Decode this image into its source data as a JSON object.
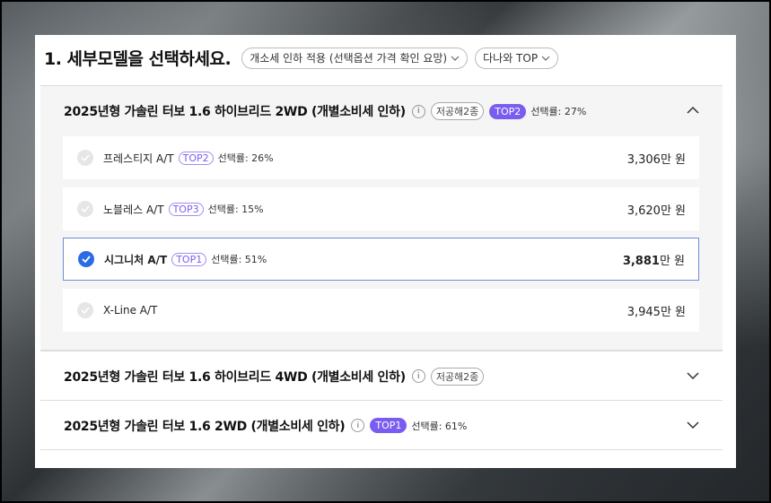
{
  "header": {
    "title": "1. 세부모델을 선택하세요.",
    "filter_label": "개소세 인하 적용 (선택옵션 가격 확인 요망)",
    "sort_label": "다나와 TOP"
  },
  "sections": [
    {
      "title": "2025년형 가솔린 터보 1.6 하이브리드 2WD (개별소비세 인하)",
      "tag": "저공해2종",
      "top": "TOP2",
      "rate": "선택률: 27%",
      "options": [
        {
          "name": "프레스티지 A/T",
          "top": "TOP2",
          "rate": "선택률: 26%",
          "price": "3,306",
          "unit": "만 원"
        },
        {
          "name": "노블레스 A/T",
          "top": "TOP3",
          "rate": "선택률: 15%",
          "price": "3,620",
          "unit": "만 원"
        },
        {
          "name": "시그니처 A/T",
          "top": "TOP1",
          "rate": "선택률: 51%",
          "price": "3,881",
          "unit": "만 원"
        },
        {
          "name": "X-Line A/T",
          "price": "3,945",
          "unit": "만 원"
        }
      ]
    },
    {
      "title": "2025년형 가솔린 터보 1.6 하이브리드 4WD (개별소비세 인하)",
      "tag": "저공해2종"
    },
    {
      "title": "2025년형 가솔린 터보 1.6 2WD (개별소비세 인하)",
      "top": "TOP1",
      "rate": "선택률: 61%"
    }
  ],
  "info_glyph": "i",
  "colors": {
    "accent": "#7b5cf0",
    "selected": "#2d6be4",
    "selected_border": "#6f8cd8"
  }
}
